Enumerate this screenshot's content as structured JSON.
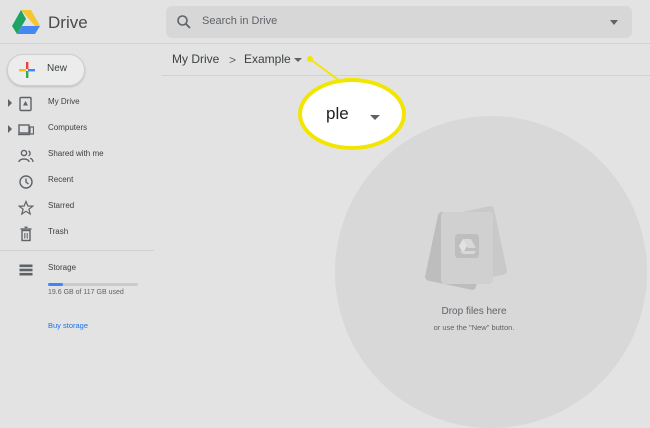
{
  "app": {
    "name": "Drive"
  },
  "search": {
    "placeholder": "Search in Drive"
  },
  "new_button": {
    "label": "New"
  },
  "sidebar": {
    "items": [
      {
        "label": "My Drive",
        "icon": "my-drive-icon",
        "expandable": true
      },
      {
        "label": "Computers",
        "icon": "computers-icon",
        "expandable": true
      },
      {
        "label": "Shared with me",
        "icon": "shared-icon",
        "expandable": false
      },
      {
        "label": "Recent",
        "icon": "clock-icon",
        "expandable": false
      },
      {
        "label": "Starred",
        "icon": "star-icon",
        "expandable": false
      },
      {
        "label": "Trash",
        "icon": "trash-icon",
        "expandable": false
      }
    ],
    "storage": {
      "label": "Storage",
      "usage_text": "19.6 GB of 117 GB used",
      "used_fraction": 0.168,
      "buy_label": "Buy storage"
    }
  },
  "breadcrumb": {
    "root": "My Drive",
    "separator": ">",
    "current": "Example"
  },
  "callout": {
    "text": "ple"
  },
  "dropzone": {
    "title": "Drop files here",
    "subtitle": "or use the \"New\" button."
  },
  "colors": {
    "accent": "#1a73e8",
    "storage_fill": "#4285f4",
    "highlight": "#f2e600",
    "overlay": "#e3e3e3"
  }
}
